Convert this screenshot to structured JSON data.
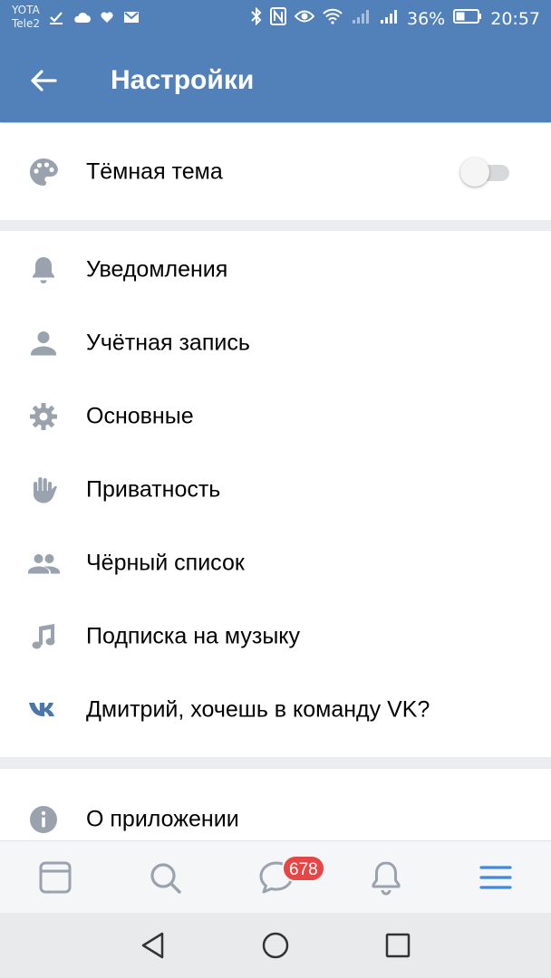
{
  "statusbar": {
    "carrier_top": "YOTA",
    "carrier_bottom": "Tele2",
    "battery": "36%",
    "time": "20:57"
  },
  "appbar": {
    "title": "Настройки"
  },
  "theme": {
    "label": "Тёмная тема",
    "enabled": false
  },
  "settings": [
    {
      "label": "Уведомления",
      "icon": "bell-icon"
    },
    {
      "label": "Учётная запись",
      "icon": "person-icon"
    },
    {
      "label": "Основные",
      "icon": "gear-icon"
    },
    {
      "label": "Приватность",
      "icon": "hand-icon"
    },
    {
      "label": "Чёрный список",
      "icon": "users-icon"
    },
    {
      "label": "Подписка на музыку",
      "icon": "music-note-icon"
    },
    {
      "label": "Дмитрий, хочешь в команду VK?",
      "icon": "vk-logo-icon"
    }
  ],
  "about": {
    "label": "О приложении",
    "icon": "info-icon"
  },
  "bottom_nav": {
    "items": [
      "news-icon",
      "search-icon",
      "messages-icon",
      "notifications-icon",
      "menu-icon"
    ],
    "messages_badge": "678",
    "active": "menu-icon"
  },
  "colors": {
    "brand": "#5181b8",
    "icon_gray": "#99a2ad",
    "badge_red": "#e64646",
    "active_blue": "#3f8ae0"
  }
}
